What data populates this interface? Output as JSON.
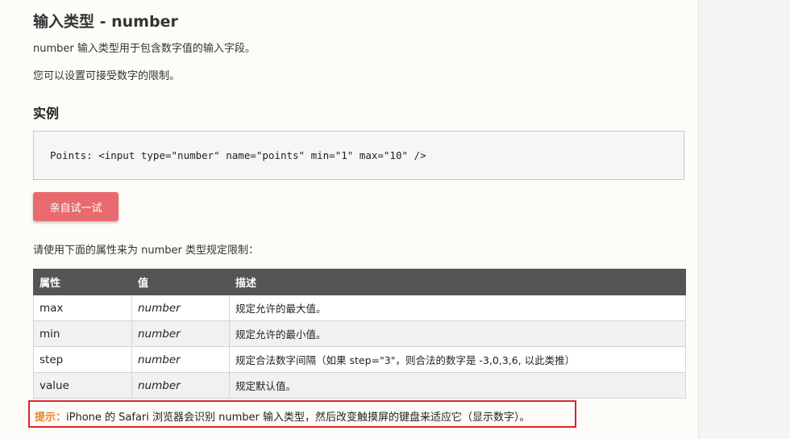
{
  "heading": "输入类型 - number",
  "intro": [
    "number 输入类型用于包含数字值的输入字段。",
    "您可以设置可接受数字的限制。"
  ],
  "example": {
    "title": "实例",
    "code": "Points: <input type=\"number\" name=\"points\" min=\"1\" max=\"10\" />",
    "button_label": "亲自试一试"
  },
  "attributes_intro": "请使用下面的属性来为 number 类型规定限制：",
  "table": {
    "headers": [
      "属性",
      "值",
      "描述"
    ],
    "rows": [
      {
        "attr": "max",
        "value": "number",
        "desc": "规定允许的最大值。"
      },
      {
        "attr": "min",
        "value": "number",
        "desc": "规定允许的最小值。"
      },
      {
        "attr": "step",
        "value": "number",
        "desc": "规定合法数字间隔（如果 step=\"3\"，则合法的数字是 -3,0,3,6, 以此类推）"
      },
      {
        "attr": "value",
        "value": "number",
        "desc": "规定默认值。"
      }
    ]
  },
  "tip": {
    "label": "提示：",
    "text": "iPhone 的 Safari 浏览器会识别 number 输入类型，然后改变触摸屏的键盘来适应它（显示数字）。"
  },
  "colors": {
    "button": "#e96b6f",
    "table_header": "#555555",
    "tip_label": "#e8832c",
    "highlight_border": "#d9262b"
  }
}
